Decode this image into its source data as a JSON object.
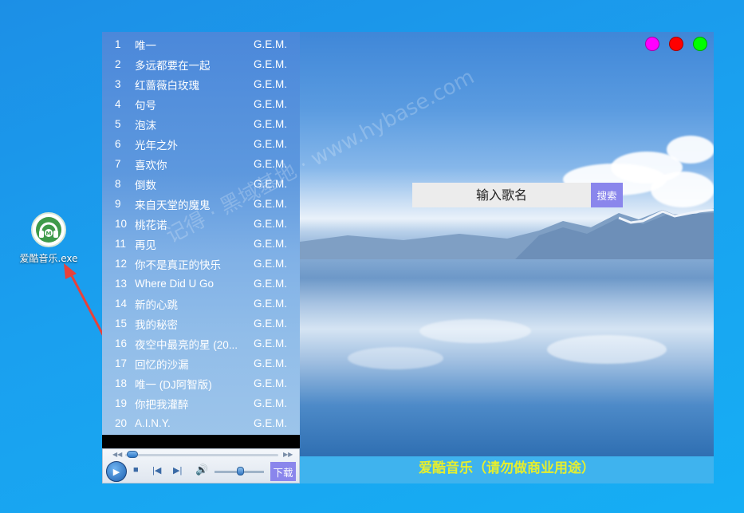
{
  "desktop": {
    "icon_label": "爱酷音乐.exe",
    "icon_name": "headphones-music-icon"
  },
  "window": {
    "controls": [
      {
        "name": "magenta",
        "color": "#ff00ff"
      },
      {
        "name": "red",
        "color": "#ff0000"
      },
      {
        "name": "green",
        "color": "#00ff00"
      }
    ],
    "search": {
      "placeholder": "输入歌名",
      "button_label": "搜索"
    },
    "footer_title": "爱酷音乐（请勿做商业用途）",
    "player": {
      "download_label": "下载",
      "play_icon": "play-icon",
      "stop_icon": "stop-icon",
      "prev_icon": "previous-icon",
      "next_icon": "next-icon",
      "volume_icon": "volume-icon"
    }
  },
  "playlist": [
    {
      "num": "1",
      "title": "唯一",
      "artist": "G.E.M."
    },
    {
      "num": "2",
      "title": "多远都要在一起",
      "artist": "G.E.M."
    },
    {
      "num": "3",
      "title": "红蔷薇白玫瑰",
      "artist": "G.E.M."
    },
    {
      "num": "4",
      "title": "句号",
      "artist": "G.E.M."
    },
    {
      "num": "5",
      "title": "泡沫",
      "artist": "G.E.M."
    },
    {
      "num": "6",
      "title": "光年之外",
      "artist": "G.E.M."
    },
    {
      "num": "7",
      "title": "喜欢你",
      "artist": "G.E.M."
    },
    {
      "num": "8",
      "title": "倒数",
      "artist": "G.E.M."
    },
    {
      "num": "9",
      "title": "来自天堂的魔鬼",
      "artist": "G.E.M."
    },
    {
      "num": "10",
      "title": "桃花诺",
      "artist": "G.E.M."
    },
    {
      "num": "11",
      "title": "再见",
      "artist": "G.E.M."
    },
    {
      "num": "12",
      "title": "你不是真正的快乐",
      "artist": "G.E.M."
    },
    {
      "num": "13",
      "title": "Where Did U Go",
      "artist": "G.E.M."
    },
    {
      "num": "14",
      "title": "新的心跳",
      "artist": "G.E.M."
    },
    {
      "num": "15",
      "title": "我的秘密",
      "artist": "G.E.M."
    },
    {
      "num": "16",
      "title": "夜空中最亮的星 (20...",
      "artist": "G.E.M."
    },
    {
      "num": "17",
      "title": "回忆的沙漏",
      "artist": "G.E.M."
    },
    {
      "num": "18",
      "title": "唯一 (DJ阿智版)",
      "artist": "G.E.M."
    },
    {
      "num": "19",
      "title": "你把我灌醉",
      "artist": "G.E.M."
    },
    {
      "num": "20",
      "title": "A.I.N.Y.",
      "artist": "G.E.M."
    }
  ]
}
